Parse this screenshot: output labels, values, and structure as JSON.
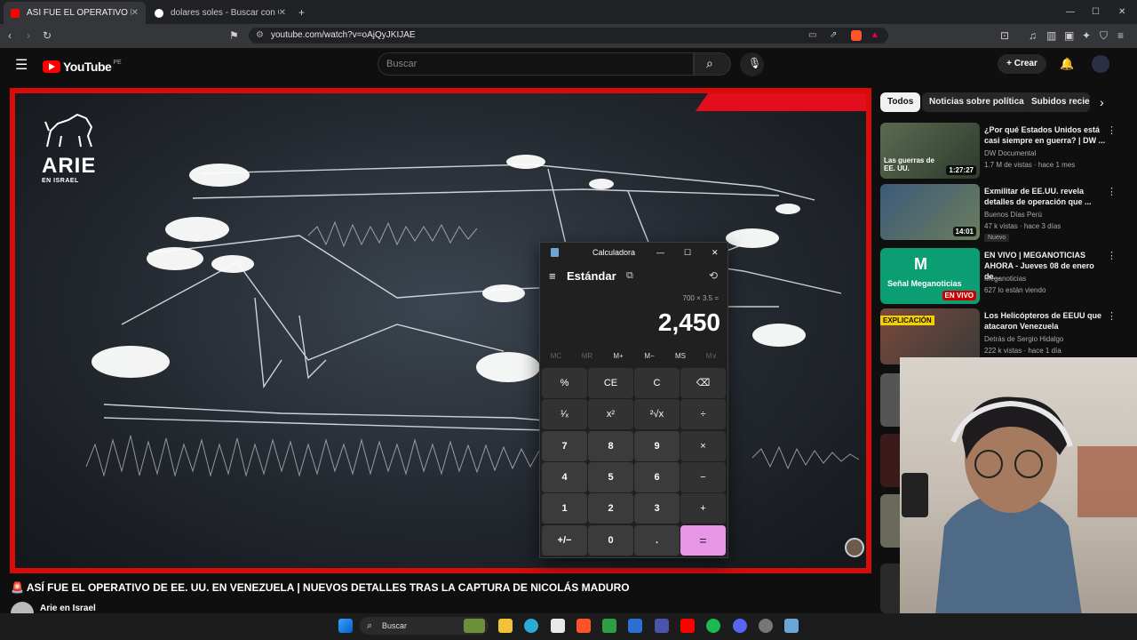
{
  "browser": {
    "tabs": [
      {
        "label": "ASÍ FUE EL OPERATIVO DE EE",
        "active": true,
        "favicon_color": "#ff0000"
      },
      {
        "label": "dolares soles - Buscar con Google",
        "active": false,
        "favicon_color": "#ffffff"
      }
    ],
    "new_tab": "+",
    "url": "youtube.com/watch?v=oAjQyJKIJAE"
  },
  "youtube": {
    "logo": "YouTube",
    "country": "PE",
    "search_placeholder": "Buscar",
    "create_label": "+ Crear"
  },
  "video": {
    "channel_logo_text": "ARIE",
    "channel_logo_sub": "EN ISRAEL",
    "title": "ASÍ FUE EL OPERATIVO DE EE. UU. EN VENEZUELA | NUEVOS DETALLES TRAS LA CAPTURA DE NICOLÁS MADURO",
    "channel": "Arie en Israel"
  },
  "sidebar": {
    "chips": [
      "Todos",
      "Noticias sobre política",
      "Subidos recien"
    ],
    "recommendations": [
      {
        "title": "¿Por qué Estados Unidos está casi siempre en guerra? | DW ...",
        "channel": "DW Documental",
        "meta": "1.7 M de vistas · hace 1 mes",
        "duration": "1:27:27",
        "thumb_text": "Las guerras de EE. UU.",
        "badge": ""
      },
      {
        "title": "Exmilitar de EE.UU. revela detalles de operación que ...",
        "channel": "Buenos Días Perú",
        "meta": "47 k vistas · hace 3 días",
        "duration": "14:01",
        "thumb_text": "",
        "badge": "Nuevo"
      },
      {
        "title": "EN VIVO | MEGANOTICIAS AHORA - Jueves 08 de enero de...",
        "channel": "Meganoticias",
        "meta": "627 lo están viendo",
        "duration": "EN VIVO",
        "thumb_text": "Señal Meganoticias",
        "badge": ""
      },
      {
        "title": "Los Helicópteros de EEUU que atacaron Venezuela",
        "channel": "Detrás de Sergio Hidalgo",
        "meta": "222 k vistas · hace 1 día",
        "duration": "",
        "thumb_text": "EXPLICACIÓN",
        "badge": ""
      }
    ]
  },
  "calculator": {
    "app_title": "Calculadora",
    "mode": "Estándar",
    "expression": "700 × 3.5 =",
    "result": "2,450",
    "memory": [
      "MC",
      "MR",
      "M+",
      "M−",
      "MS",
      "M∨"
    ],
    "keys": [
      [
        "%",
        "CE",
        "C",
        "⌫"
      ],
      [
        "¹⁄ₓ",
        "x²",
        "²√x",
        "÷"
      ],
      [
        "7",
        "8",
        "9",
        "×"
      ],
      [
        "4",
        "5",
        "6",
        "−"
      ],
      [
        "1",
        "2",
        "3",
        "+"
      ],
      [
        "+/−",
        "0",
        ".",
        "="
      ]
    ]
  },
  "taskbar": {
    "search": "Buscar"
  }
}
